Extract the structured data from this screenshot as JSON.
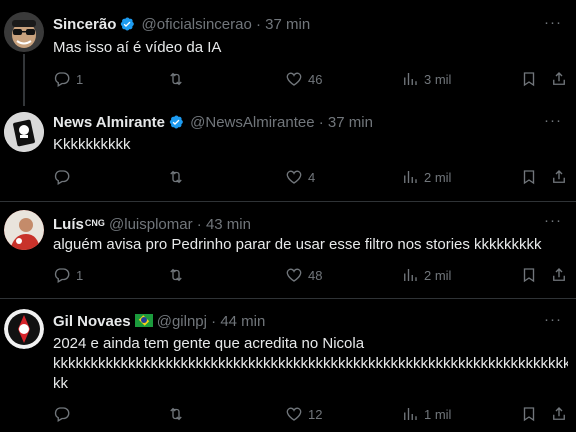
{
  "colors": {
    "background": "#000000",
    "text": "#e7e9ea",
    "muted": "#71767b",
    "verified": "#1d9bf0",
    "divider": "#2f3336"
  },
  "tweets": [
    {
      "name": "Sincerão",
      "handle": "@oficialsincerao",
      "time": "· 37 min",
      "verified": true,
      "text": "Mas isso aí é vídeo da IA",
      "replies": "1",
      "retweets": "",
      "likes": "46",
      "views": "3 mil"
    },
    {
      "name": "News Almirante",
      "handle": "@NewsAlmirantee",
      "time": "· 37 min",
      "verified": true,
      "text": "Kkkkkkkkkk",
      "replies": "",
      "retweets": "",
      "likes": "4",
      "views": "2 mil"
    },
    {
      "name": "Luís",
      "affiliation": "CNG",
      "handle": "@luisplomar",
      "time": "· 43 min",
      "verified": false,
      "text": "alguém avisa pro Pedrinho parar de usar esse filtro nos stories kkkkkkkkk",
      "replies": "1",
      "retweets": "",
      "likes": "48",
      "views": "2 mil"
    },
    {
      "name": "Gil Novaes",
      "flag": "brazil-flag",
      "handle": "@gilnpj",
      "time": "· 44 min",
      "verified": false,
      "text_line1": "2024 e ainda tem gente que acredita no Nicola",
      "text_line2": "kkkkkkkkkkkkkkkkkkkkkkkkkkkkkkkkkkkkkkkkkkkkkkkkkkkkkkkkkkkkkkkkkkkkkkk",
      "text_line3": "kk",
      "replies": "",
      "retweets": "",
      "likes": "12",
      "views": "1 mil"
    }
  ],
  "more_label": "···"
}
